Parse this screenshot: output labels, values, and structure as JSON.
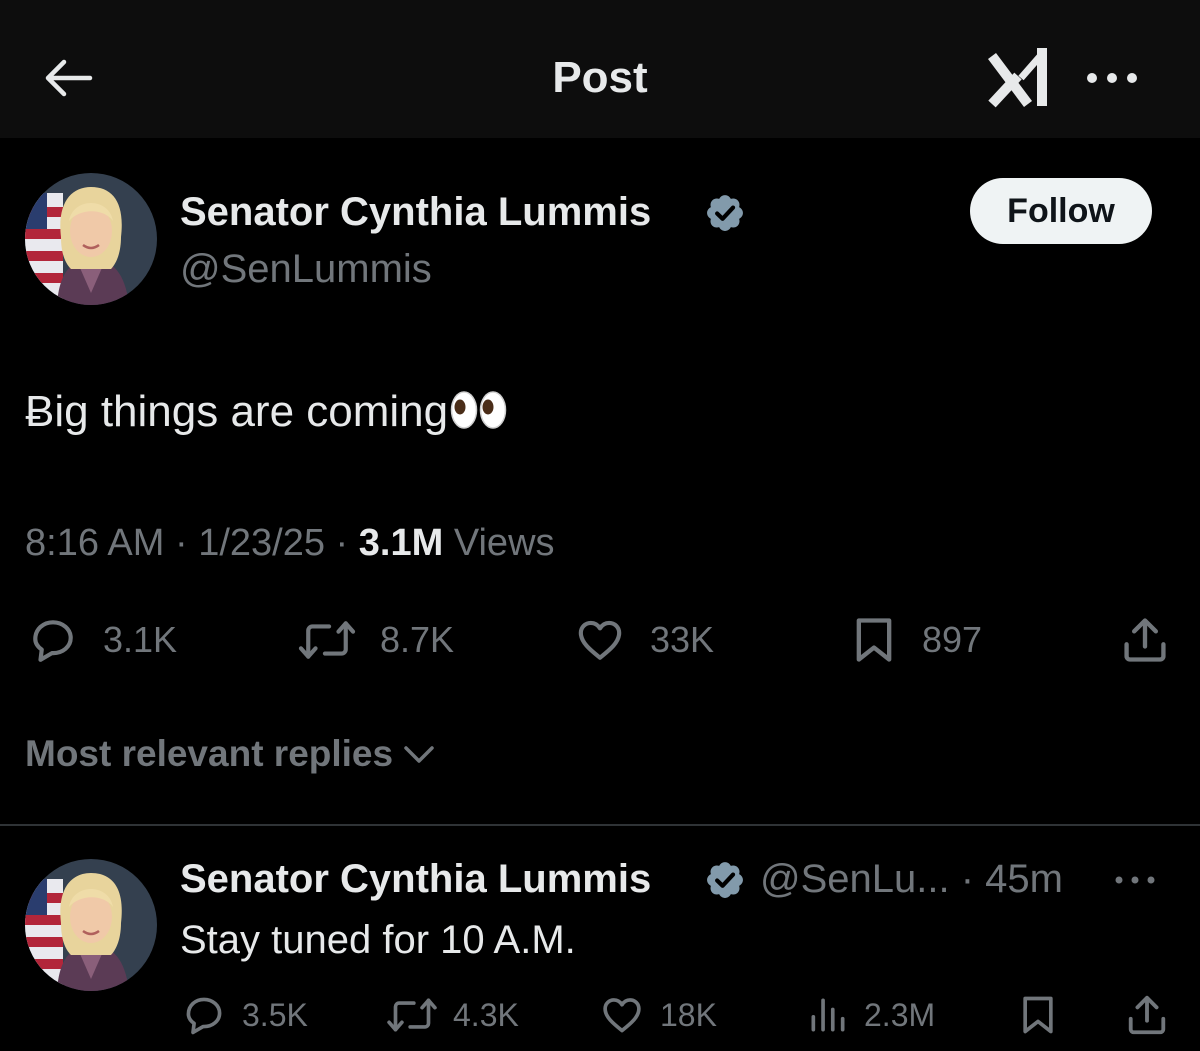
{
  "header": {
    "title": "Post",
    "back_icon": "arrow-left-icon",
    "grok_icon": "grok-icon",
    "more_icon": "more-horizontal-icon"
  },
  "post": {
    "author_name": "Senator Cynthia Lummis",
    "author_handle": "@SenLummis",
    "follow_label": "Follow",
    "text": "Ƀig things are coming",
    "emoji": "eyes-emoji",
    "time": "8:16 AM",
    "date": "1/23/25",
    "views_count": "3.1M",
    "views_label": "Views",
    "stats": {
      "replies": "3.1K",
      "reposts": "8.7K",
      "likes": "33K",
      "bookmarks": "897"
    }
  },
  "replies_sort": {
    "label": "Most relevant replies"
  },
  "reply": {
    "author_name": "Senator Cynthia Lummis",
    "author_handle": "@SenLu...",
    "age": "45m",
    "text": "Stay tuned for 10 A.M.",
    "stats": {
      "replies": "3.5K",
      "reposts": "4.3K",
      "likes": "18K",
      "views": "2.3M"
    }
  },
  "colors": {
    "background": "#000000",
    "header_background": "#0d0d0d",
    "primary_text": "#e7e9ea",
    "secondary_text": "#71767b",
    "verified_badge": "#829aab",
    "follow_button": "#eff3f4",
    "divider": "#2f3336"
  }
}
